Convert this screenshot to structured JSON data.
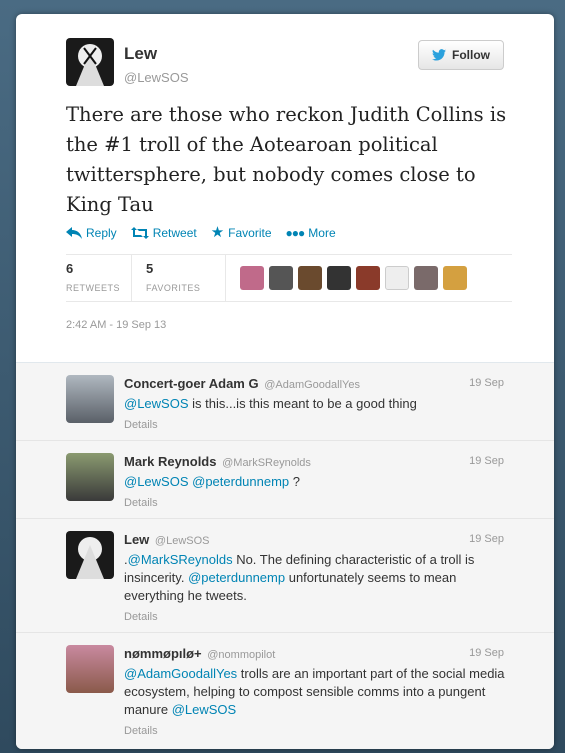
{
  "tweet": {
    "author_name": "Lew",
    "author_handle": "@LewSOS",
    "follow_label": "Follow",
    "text": "There are those who reckon Judith Collins is the #1 troll of the Aotearoan political twittersphere, but nobody comes close to King Tau",
    "actions": {
      "reply": "Reply",
      "retweet": "Retweet",
      "favorite": "Favorite",
      "more": "More"
    },
    "retweets_count": "6",
    "retweets_label": "RETWEETS",
    "favorites_count": "5",
    "favorites_label": "FAVORITES",
    "timestamp": "2:42 AM - 19 Sep 13"
  },
  "replies": [
    {
      "name": "Concert-goer Adam G",
      "handle": "@AdamGoodallYes",
      "date": "19 Sep",
      "parts": [
        {
          "t": "@LewSOS",
          "link": true
        },
        {
          "t": " is this...is this meant to be a good thing",
          "link": false
        }
      ],
      "details": "Details"
    },
    {
      "name": "Mark Reynolds",
      "handle": "@MarkSReynolds",
      "date": "19 Sep",
      "parts": [
        {
          "t": "@LewSOS",
          "link": true
        },
        {
          "t": " ",
          "link": false
        },
        {
          "t": "@peterdunnemp",
          "link": true
        },
        {
          "t": " ?",
          "link": false
        }
      ],
      "details": "Details"
    },
    {
      "name": "Lew",
      "handle": "@LewSOS",
      "date": "19 Sep",
      "parts": [
        {
          "t": ".",
          "link": false
        },
        {
          "t": "@MarkSReynolds",
          "link": true
        },
        {
          "t": " No. The defining characteristic of a troll is insincerity. ",
          "link": false
        },
        {
          "t": "@peterdunnemp",
          "link": true
        },
        {
          "t": " unfortunately seems to mean everything he tweets.",
          "link": false
        }
      ],
      "details": "Details"
    },
    {
      "name": "nømmøpılø+",
      "handle": "@nommopilot",
      "date": "19 Sep",
      "parts": [
        {
          "t": "@AdamGoodallYes",
          "link": true
        },
        {
          "t": " trolls are an important part of the social media ecosystem, helping to compost sensible comms into a pungent manure ",
          "link": false
        },
        {
          "t": "@LewSOS",
          "link": true
        }
      ],
      "details": "Details"
    }
  ],
  "colors": {
    "link": "#0084b4",
    "background": "#3f5e74"
  }
}
